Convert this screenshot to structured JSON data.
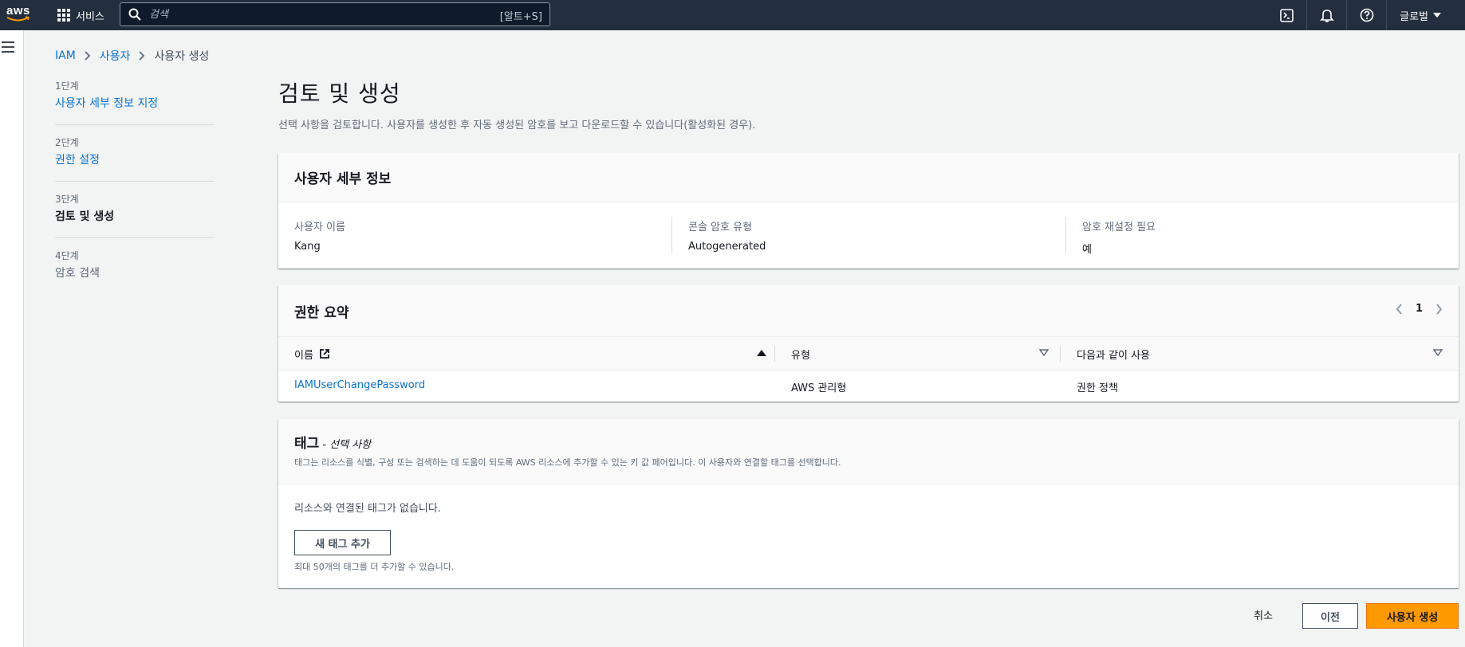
{
  "topnav": {
    "logo_text": "aws",
    "services_label": "서비스",
    "search_placeholder": "검색",
    "search_hint": "[알트+S]",
    "region_label": "글로벌"
  },
  "breadcrumb": [
    "IAM",
    "사용자",
    "사용자 생성"
  ],
  "steps": [
    {
      "num": "1단계",
      "label": "사용자 세부 정보 지정"
    },
    {
      "num": "2단계",
      "label": "권한 설정"
    },
    {
      "num": "3단계",
      "label": "검토 및 생성"
    },
    {
      "num": "4단계",
      "label": "암호 검색"
    }
  ],
  "page": {
    "title": "검토 및 생성",
    "subtitle": "선택 사항을 검토합니다. 사용자를 생성한 후 자동 생성된 암호를 보고 다운로드할 수 있습니다(활성화된 경우)."
  },
  "user_details": {
    "heading": "사용자 세부 정보",
    "fields": [
      {
        "key": "사용자 이름",
        "value": "Kang"
      },
      {
        "key": "콘솔 암호 유형",
        "value": "Autogenerated"
      },
      {
        "key": "암호 재설정 필요",
        "value": "예"
      }
    ]
  },
  "permissions": {
    "heading": "권한 요약",
    "page": "1",
    "columns": [
      "이름",
      "유형",
      "다음과 같이 사용"
    ],
    "rows": [
      {
        "name": "IAMUserChangePassword",
        "type": "AWS 관리형",
        "used_as": "권한 정책"
      }
    ]
  },
  "tags": {
    "heading": "태그",
    "optional": "- 선택 사항",
    "description": "태그는 리소스를 식별, 구성 또는 검색하는 데 도움이 되도록 AWS 리소스에 추가할 수 있는 키 값 페어입니다. 이 사용자와 연결할 태그를 선택합니다.",
    "empty": "리소스와 연결된 태그가 없습니다.",
    "add_button": "새 태그 추가",
    "limit": "최대 50개의 태그를 더 추가할 수 있습니다."
  },
  "footer": {
    "cancel": "취소",
    "previous": "이전",
    "create": "사용자 생성"
  },
  "colors": {
    "nav_bg": "#232f3e",
    "link": "#0972d3",
    "primary": "#ff9900"
  }
}
